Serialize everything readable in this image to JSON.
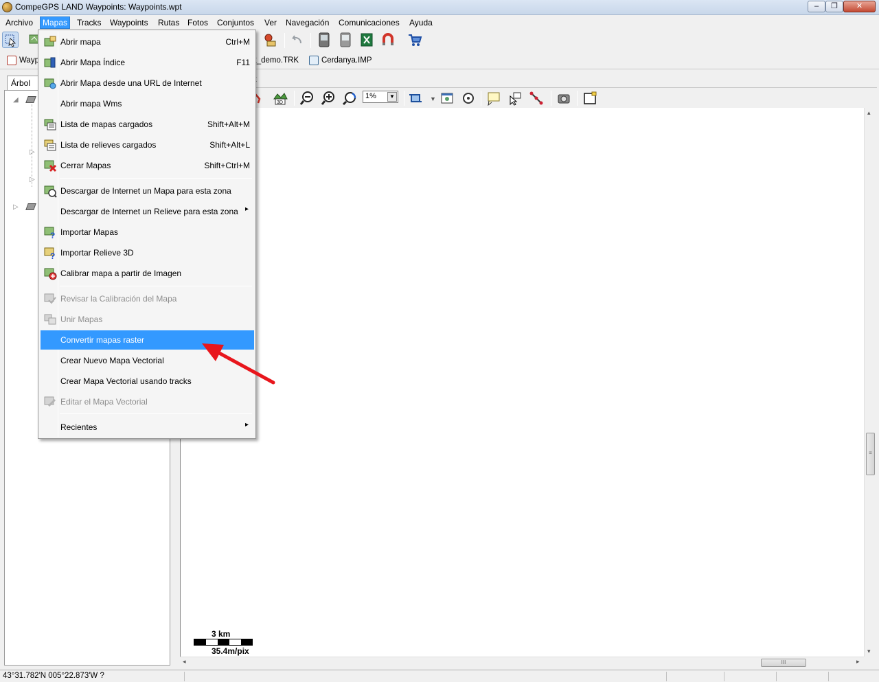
{
  "window": {
    "title": "CompeGPS LAND Waypoints:  Waypoints.wpt",
    "minimize_glyph": "–",
    "maximize_glyph": "❐",
    "close_glyph": "✕"
  },
  "menubar": {
    "items": [
      "Archivo",
      "Mapas",
      "Tracks",
      "Waypoints",
      "Rutas",
      "Fotos",
      "Conjuntos",
      "Ver",
      "Navegación",
      "Comunicaciones",
      "Ayuda"
    ],
    "active": "Mapas"
  },
  "doc_tabs": [
    {
      "label": "Wayp",
      "icon": "waypoint-file-icon"
    },
    {
      "label": "k_demo.TRK",
      "icon": "track-file-icon"
    },
    {
      "label": "Cerdanya.IMP",
      "icon": "map-file-icon"
    }
  ],
  "left_panel": {
    "tab_label": "Árbol"
  },
  "map_view": {
    "tab_close": "x",
    "zoom_value": "1%",
    "zoom_arrow": "▼",
    "scale_km": "3 km",
    "scale_mpix": "35.4m/pix",
    "hscroll_grip": "III",
    "vscroll_grip": "≡",
    "arrow_left": "◂",
    "arrow_right": "▸",
    "arrow_up": "▴",
    "arrow_down": "▾"
  },
  "statusbar": {
    "coords": "43°31.782'N 005°22.873'W  ?"
  },
  "mapas_menu": {
    "items": [
      {
        "label": "Abrir mapa",
        "shortcut": "Ctrl+M",
        "icon": "open-map-icon",
        "enabled": true
      },
      {
        "label": "Abrir Mapa Índice",
        "shortcut": "F11",
        "icon": "index-map-icon",
        "enabled": true
      },
      {
        "label": "Abrir Mapa desde una URL de Internet",
        "shortcut": "",
        "icon": "url-map-icon",
        "enabled": true
      },
      {
        "label": "Abrir mapa Wms",
        "shortcut": "",
        "icon": "",
        "enabled": true
      },
      {
        "label": "Lista de mapas cargados",
        "shortcut": "Shift+Alt+M",
        "icon": "map-list-icon",
        "enabled": true
      },
      {
        "label": "Lista de relieves cargados",
        "shortcut": "Shift+Alt+L",
        "icon": "relief-list-icon",
        "enabled": true
      },
      {
        "label": "Cerrar Mapas",
        "shortcut": "Shift+Ctrl+M",
        "icon": "close-maps-icon",
        "enabled": true
      },
      {
        "label": "Descargar de Internet un Mapa para esta zona",
        "shortcut": "",
        "icon": "download-map-icon",
        "enabled": true
      },
      {
        "label": "Descargar de Internet un Relieve para esta zona",
        "shortcut": "",
        "icon": "",
        "enabled": true,
        "submenu": "▸"
      },
      {
        "label": "Importar Mapas",
        "shortcut": "",
        "icon": "import-maps-icon",
        "enabled": true
      },
      {
        "label": "Importar Relieve 3D",
        "shortcut": "",
        "icon": "import-relief-icon",
        "enabled": true
      },
      {
        "label": "Calibrar mapa a partir de Imagen",
        "shortcut": "",
        "icon": "calibrate-map-icon",
        "enabled": true
      },
      {
        "label": "Revisar la Calibración del Mapa",
        "shortcut": "",
        "icon": "review-calibration-icon",
        "enabled": false
      },
      {
        "label": "Unir Mapas",
        "shortcut": "",
        "icon": "join-maps-icon",
        "enabled": false
      },
      {
        "label": "Convertir mapas raster",
        "shortcut": "",
        "icon": "",
        "enabled": true,
        "highlighted": true
      },
      {
        "label": "Crear Nuevo Mapa Vectorial",
        "shortcut": "",
        "icon": "",
        "enabled": true
      },
      {
        "label": "Crear Mapa Vectorial usando tracks",
        "shortcut": "",
        "icon": "",
        "enabled": true
      },
      {
        "label": "Editar el Mapa Vectorial",
        "shortcut": "",
        "icon": "edit-vector-map-icon",
        "enabled": false
      },
      {
        "label": "Recientes",
        "shortcut": "",
        "icon": "",
        "enabled": true,
        "submenu": "▸"
      }
    ]
  },
  "colors": {
    "highlight": "#3399ff",
    "annotation_arrow": "#e8161c"
  }
}
